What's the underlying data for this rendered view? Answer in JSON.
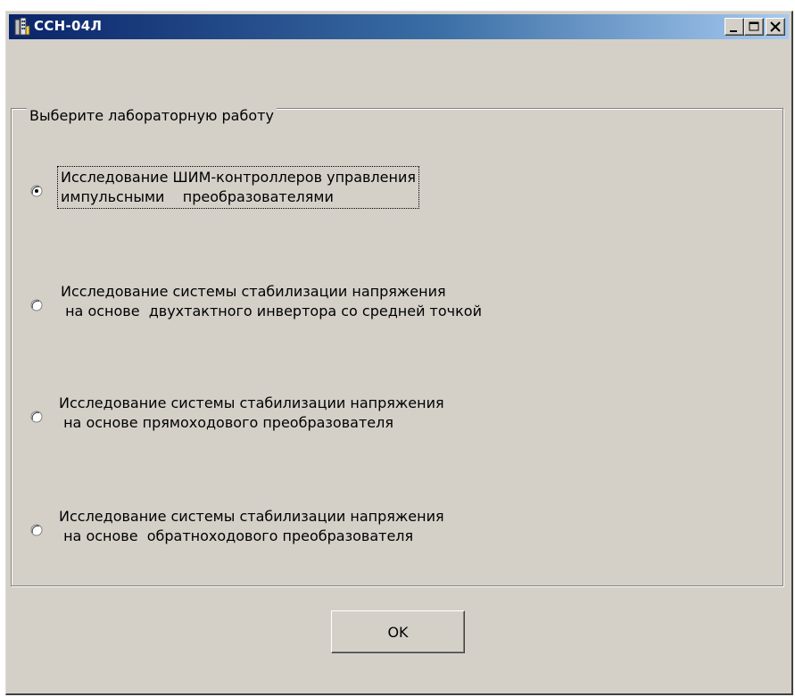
{
  "window": {
    "title": "ССН-04Л",
    "icon": "app-building-icon",
    "controls": [
      "minimize-icon",
      "maximize-icon",
      "close-icon"
    ]
  },
  "group": {
    "caption": "Выберите лабораторную работу",
    "options": [
      {
        "line1": "Исследование ШИМ-контроллеров управления",
        "line2": "импульсными    преобразователями",
        "selected": true
      },
      {
        "line1": "Исследование системы стабилизации напряжения",
        "line2": " на основе  двухтактного инвертора со средней точкой",
        "selected": false
      },
      {
        "line1": "Исследование системы стабилизации напряжения",
        "line2": " на основе прямоходового преобразователя",
        "selected": false
      },
      {
        "line1": "Исследование системы стабилизации напряжения",
        "line2": " на основе  обратноходового преобразователя",
        "selected": false
      }
    ]
  },
  "ok_button": {
    "label": "OK"
  },
  "colors": {
    "face": "#d4d0c8",
    "title_start": "#0a246a",
    "title_end": "#a6caf0"
  }
}
